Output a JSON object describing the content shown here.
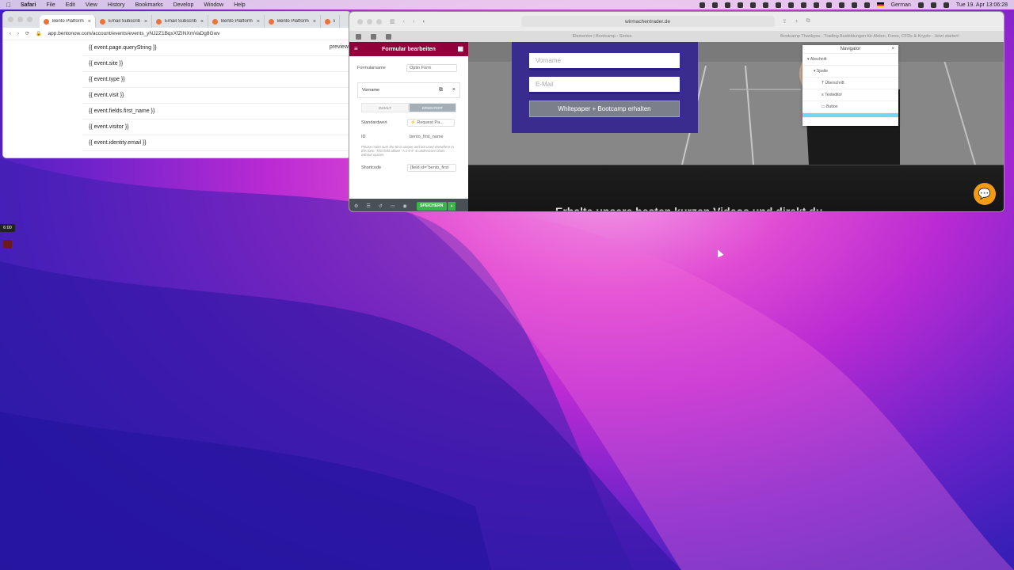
{
  "menubar": {
    "app": "Safari",
    "items": [
      "File",
      "Edit",
      "View",
      "History",
      "Bookmarks",
      "Develop",
      "Window",
      "Help"
    ],
    "language": "German",
    "clock": "Tue 19. Apr 13:06:28"
  },
  "chrome_window": {
    "tabs": [
      {
        "title": "Bento Platform",
        "active": true
      },
      {
        "title": "Email Subscrib",
        "active": false
      },
      {
        "title": "Email Subscrib",
        "active": false
      },
      {
        "title": "Bento Platform",
        "active": false
      },
      {
        "title": "Bento Platform",
        "active": false
      },
      {
        "title": "Bent",
        "active": false
      }
    ],
    "url": "app.bentonow.com/account/events/events_yNJ2Z1BqxXfZINXmVaDg8Gwv",
    "preview_label": "preview",
    "variables": [
      "{{ event.page.queryString }}",
      "{{ event.site }}",
      "{{ event.type }}",
      "{{ event.visit }}",
      "{{ event.fields.first_name }}",
      "{{ event.visitor }}",
      "{{ event.identity.email }}"
    ]
  },
  "safari_window": {
    "url": "wirmachentrader.de",
    "tab1": "Elementor | Bootcamp - Series",
    "tab2": "Bootcamp Thankyou - Trading Ausbildungen für Aktien, Forex, CFDs & Krypto - Jetzt starten!"
  },
  "panel": {
    "title": "Formular bearbeiten",
    "form_name_label": "Formularname",
    "form_name_value": "Optin Form",
    "field_label": "Vorname",
    "tab_content": "INHALT",
    "tab_advanced": "ERWEITERT",
    "default_label": "Standardwert",
    "default_value": "Request Pa...",
    "id_label": "ID",
    "id_value": "bento_first_name",
    "note": "Please make sure the ID is unique and not used elsewhere in this form. This field allows `A-z 0-9` & underscore chars without spaces.",
    "shortcode_label": "Shortcode",
    "shortcode_value": "[field id=\"bento_first",
    "save_label": "SPEICHERN"
  },
  "canvas": {
    "input_firstname_placeholder": "Vorname",
    "input_email_placeholder": "E-Mail",
    "button_label": "Whitepaper + Bootcamp erhalten",
    "headline": "Erhalte unsere besten kurzen Videos und direkt du"
  },
  "navigator": {
    "title": "Navigator",
    "items": [
      "Abschnitt",
      "Spalte",
      "Überschrift",
      "Texteditor",
      "Button"
    ]
  },
  "recording_time": "6:00"
}
